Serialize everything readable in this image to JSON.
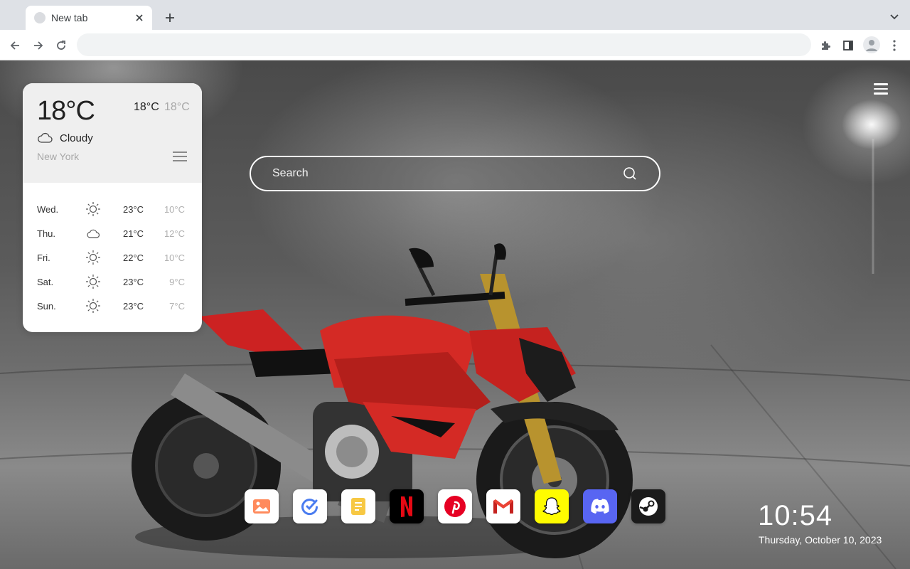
{
  "browser": {
    "tab": {
      "title": "New tab"
    },
    "omnibox": {
      "value": ""
    },
    "icons": {
      "close": "close-icon",
      "new_tab": "plus-icon",
      "tab_search": "chevron-down-icon",
      "back": "arrow-left-icon",
      "forward": "arrow-right-icon",
      "reload": "reload-icon",
      "extensions": "puzzle-icon",
      "side_panel": "side-panel-icon",
      "profile": "avatar-icon",
      "menu": "kebab-menu-icon"
    }
  },
  "weather": {
    "current_temp": "18°C",
    "high": "18°C",
    "low": "18°C",
    "condition": "Cloudy",
    "city": "New York",
    "forecast": [
      {
        "day": "Wed.",
        "icon": "sun-icon",
        "high": "23°C",
        "low": "10°C"
      },
      {
        "day": "Thu.",
        "icon": "cloud-icon",
        "high": "21°C",
        "low": "12°C"
      },
      {
        "day": "Fri.",
        "icon": "sun-icon",
        "high": "22°C",
        "low": "10°C"
      },
      {
        "day": "Sat.",
        "icon": "sun-icon",
        "high": "23°C",
        "low": "9°C"
      },
      {
        "day": "Sun.",
        "icon": "sun-icon",
        "high": "23°C",
        "low": "7°C"
      }
    ]
  },
  "search": {
    "placeholder": "Search"
  },
  "dock": {
    "apps": [
      {
        "name": "photos",
        "color": "#ffffff"
      },
      {
        "name": "tasks",
        "color": "#ffffff"
      },
      {
        "name": "notes",
        "color": "#ffffff"
      },
      {
        "name": "netflix",
        "color": "#000000"
      },
      {
        "name": "pinterest",
        "color": "#ffffff"
      },
      {
        "name": "gmail",
        "color": "#ffffff"
      },
      {
        "name": "snapchat",
        "color": "#fffc00"
      },
      {
        "name": "discord",
        "color": "#5865f2"
      },
      {
        "name": "steam",
        "color": "#1b1b1b"
      }
    ]
  },
  "clock": {
    "time": "10:54",
    "date": "Thursday, October 10, 2023"
  }
}
